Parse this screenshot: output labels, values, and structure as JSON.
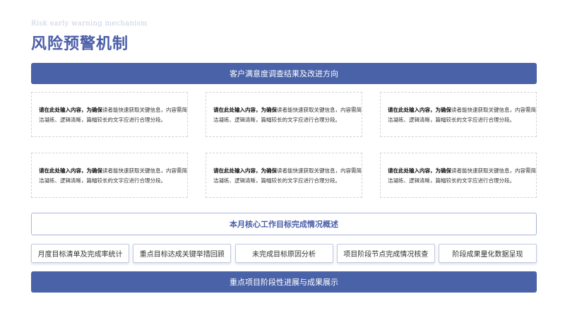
{
  "header": {
    "subtitle_en": "Risk early warning mechanism",
    "title": "风险预警机制"
  },
  "banner_top": "客户满意度调查结果及改进方向",
  "cards": [
    {
      "bold": "请在此处输入内容，为确保",
      "rest": "读者能快速获取关键信息，内容需简洁凝练、逻辑清晰，篇幅较长的文字应进行合理分段。"
    },
    {
      "bold": "请在此处输入内容，为确保",
      "rest": "读者能快速获取关键信息，内容需简洁凝练、逻辑清晰，篇幅较长的文字应进行合理分段。"
    },
    {
      "bold": "请在此处输入内容，为确保",
      "rest": "读者能快速获取关键信息，内容需简洁凝练、逻辑清晰，篇幅较长的文字应进行合理分段。"
    },
    {
      "bold": "请在此处输入内容，为确保",
      "rest": "读者能快速获取关键信息，内容需简洁凝练、逻辑清晰，篇幅较长的文字应进行合理分段。"
    },
    {
      "bold": "请在此处输入内容，为确保",
      "rest": "读者能快速获取关键信息，内容需简洁凝练、逻辑清晰，篇幅较长的文字应进行合理分段。"
    },
    {
      "bold": "请在此处输入内容，为确保",
      "rest": "读者能快速获取关键信息，内容需简洁凝练、逻辑清晰，篇幅较长的文字应进行合理分段。"
    }
  ],
  "summary_banner": "本月核心工作目标完成情况概述",
  "tags": [
    "月度目标清单及完成率统计",
    "重点目标达成关键举措回顾",
    "未完成目标原因分析",
    "项目阶段节点完成情况核查",
    "阶段成果量化数据呈现"
  ],
  "banner_bottom": "重点项目阶段性进展与成果展示",
  "colors": {
    "accent": "#4a62a8",
    "title": "#4a5ea8",
    "subtitle": "#c9cfe6"
  }
}
